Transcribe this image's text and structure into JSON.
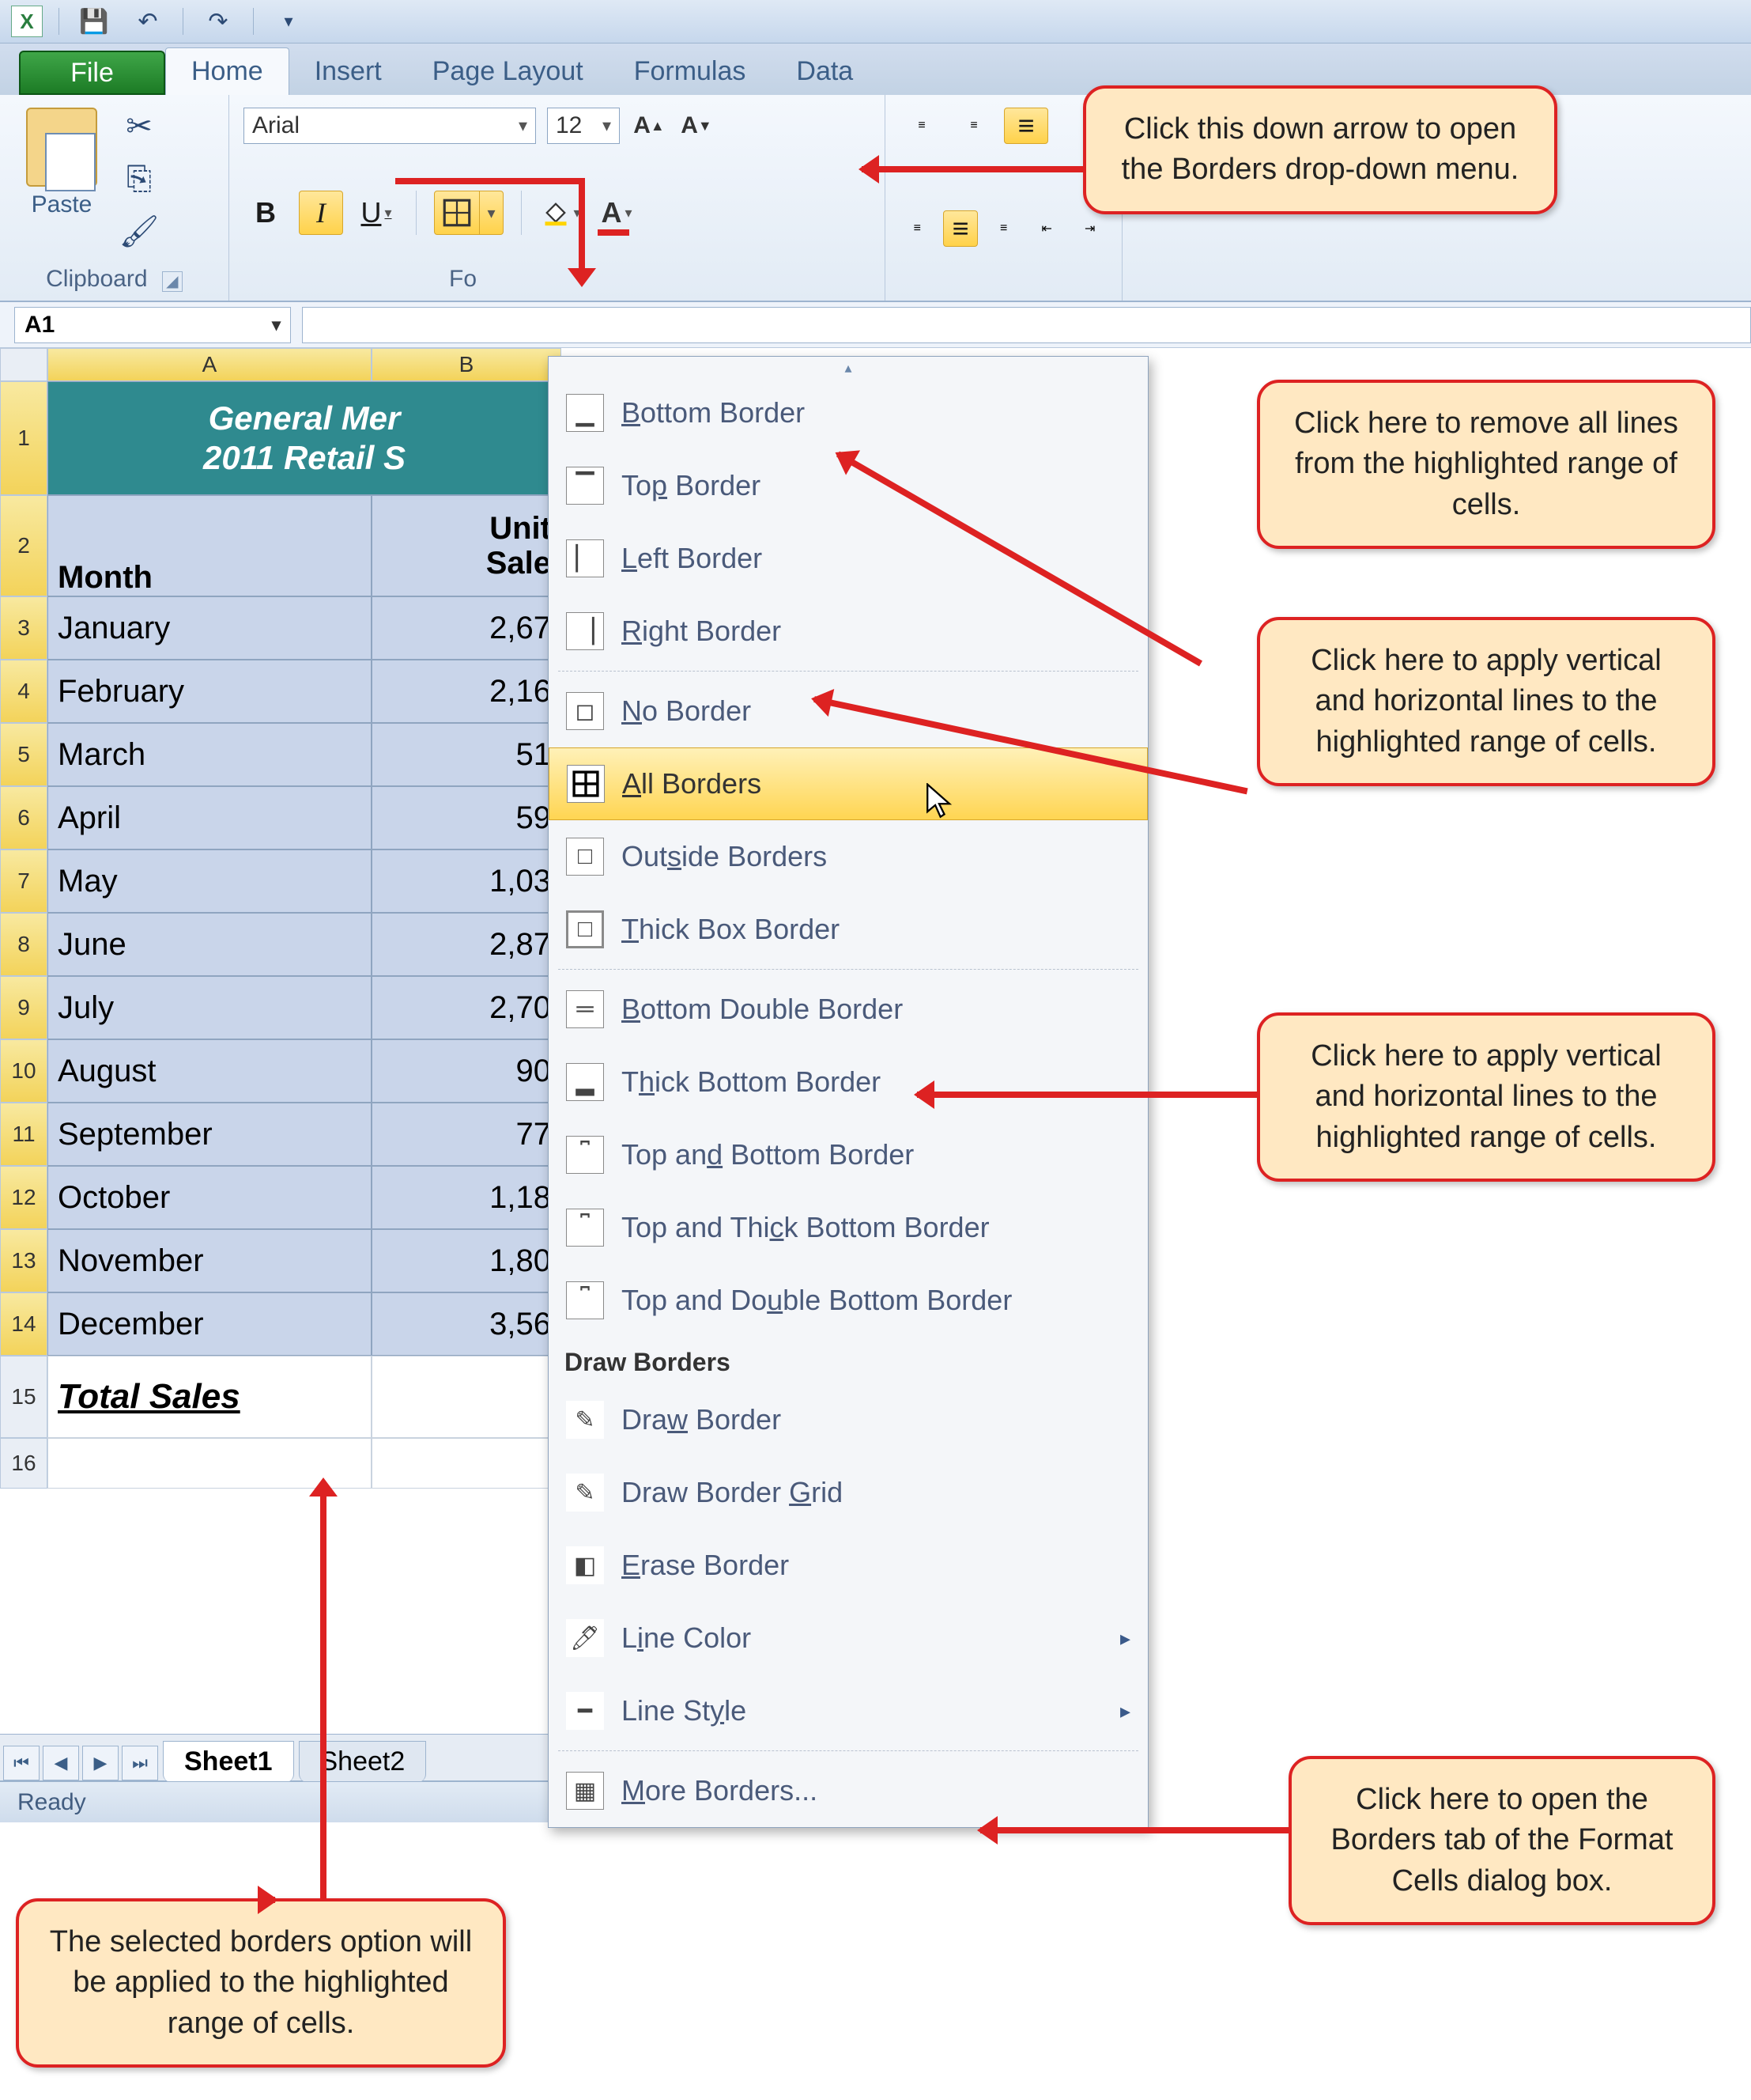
{
  "qat": {
    "save": "💾",
    "undo": "↶",
    "redo": "↷",
    "customize": "▾"
  },
  "tabs": {
    "file": "File",
    "home": "Home",
    "insert": "Insert",
    "page_layout": "Page Layout",
    "formulas": "Formulas",
    "data": "Data"
  },
  "ribbon": {
    "clipboard": {
      "paste": "Paste",
      "label": "Clipboard"
    },
    "font": {
      "name": "Arial",
      "size": "12",
      "label": "Fo",
      "bold": "B",
      "italic": "I",
      "underline": "U"
    }
  },
  "namebox": "A1",
  "sheet": {
    "title1": "General Mer",
    "title2": "2011 Retail S",
    "headerA": "Month",
    "headerB_line1": "Unit",
    "headerB_line2": "Sale",
    "rows": [
      {
        "n": "3",
        "a": "January",
        "b": "2,67"
      },
      {
        "n": "4",
        "a": "February",
        "b": "2,16"
      },
      {
        "n": "5",
        "a": "March",
        "b": "51"
      },
      {
        "n": "6",
        "a": "April",
        "b": "59"
      },
      {
        "n": "7",
        "a": "May",
        "b": "1,03"
      },
      {
        "n": "8",
        "a": "June",
        "b": "2,87"
      },
      {
        "n": "9",
        "a": "July",
        "b": "2,70"
      },
      {
        "n": "10",
        "a": "August",
        "b": "90"
      },
      {
        "n": "11",
        "a": "September",
        "b": "77"
      },
      {
        "n": "12",
        "a": "October",
        "b": "1,18"
      },
      {
        "n": "13",
        "a": "November",
        "b": "1,80"
      },
      {
        "n": "14",
        "a": "December",
        "b": "3,56"
      }
    ],
    "total_row": "15",
    "total_label": "Total Sales",
    "blank_row": "16"
  },
  "dropdown": {
    "bottom": "Bottom Border",
    "top": "Top Border",
    "left": "Left Border",
    "right": "Right Border",
    "none": "No Border",
    "all": "All Borders",
    "outside": "Outside Borders",
    "thick_box": "Thick Box Border",
    "bottom_double": "Bottom Double Border",
    "thick_bottom": "Thick Bottom Border",
    "top_bottom": "Top and Bottom Border",
    "top_thick_bottom": "Top and Thick Bottom Border",
    "top_double_bottom": "Top and Double Bottom Border",
    "section": "Draw Borders",
    "draw": "Draw Border",
    "draw_grid": "Draw Border Grid",
    "erase": "Erase Border",
    "line_color": "Line Color",
    "line_style": "Line Style",
    "more": "More Borders..."
  },
  "sheettabs": {
    "s1": "Sheet1",
    "s2": "Sheet2"
  },
  "status": "Ready",
  "callouts": {
    "c1": "Click this down arrow to open the Borders drop-down menu.",
    "c2": "Click here to remove all lines from the highlighted range of cells.",
    "c3": "Click here to apply vertical and horizontal lines to the highlighted range of cells.",
    "c4": "Click here to apply vertical and horizontal lines to the highlighted range of cells.",
    "c5": "Click here to open the Borders tab of the Format Cells dialog box.",
    "c6": "The selected borders option will be applied to the highlighted range of cells."
  }
}
